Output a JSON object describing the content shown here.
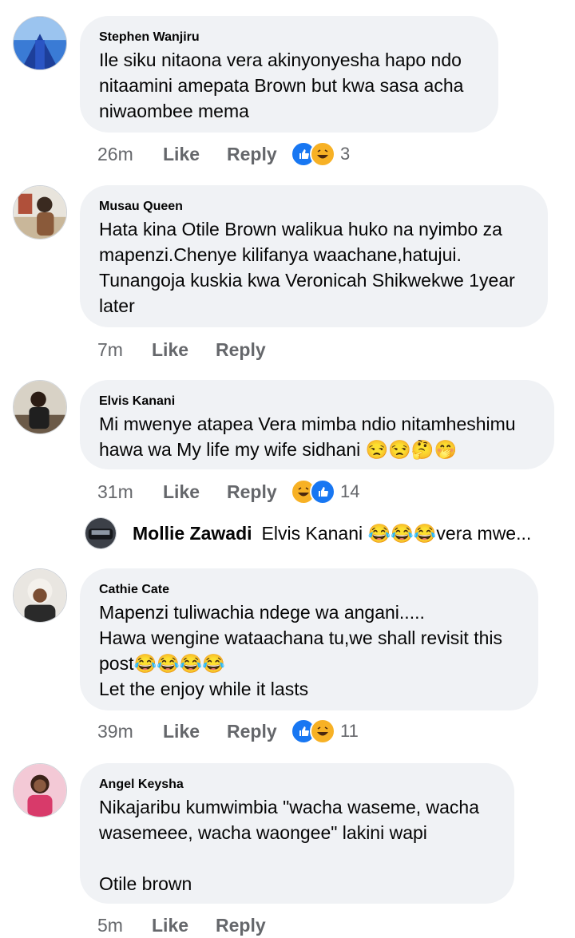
{
  "comments": [
    {
      "author": "Stephen Wanjiru",
      "text": "Ile siku nitaona vera akinyonyesha hapo ndo\nnitaamini amepata Brown but kwa sasa acha\nniwaombee mema",
      "time": "26m",
      "like": "Like",
      "reply": "Reply",
      "reactions": [
        "like",
        "haha"
      ],
      "reaction_count": "3"
    },
    {
      "author": "Musau Queen",
      "text": "Hata kina Otile Brown walikua huko na nyimbo za\nmapenzi.Chenye kilifanya waachane,hatujui.\nTunangoja kuskia kwa Veronicah Shikwekwe 1year\nlater",
      "time": "7m",
      "like": "Like",
      "reply": "Reply"
    },
    {
      "author": "Elvis Kanani",
      "text": "Mi mwenye atapea Vera mimba ndio nitamheshimu\nhawa wa My life my wife sidhani 😒😒🤔🤭",
      "time": "31m",
      "like": "Like",
      "reply": "Reply",
      "reactions": [
        "haha",
        "like"
      ],
      "reaction_count": "14"
    },
    {
      "author": "Cathie Cate",
      "text": "Mapenzi tuliwachia ndege wa angani.....\nHawa wengine wataachana tu,we shall revisit this\npost😂😂😂😂\nLet the enjoy while it lasts",
      "time": "39m",
      "like": "Like",
      "reply": "Reply",
      "reactions": [
        "like",
        "haha"
      ],
      "reaction_count": "11"
    },
    {
      "author": "Angel Keysha",
      "text": "Nikajaribu kumwimbia \"wacha waseme, wacha\nwasemeee, wacha waongee\" lakini wapi\n\nOtile brown",
      "time": "5m",
      "like": "Like",
      "reply": "Reply"
    }
  ],
  "nested_reply": {
    "author": "Mollie Zawadi",
    "text": "Elvis Kanani 😂😂😂vera mwe..."
  }
}
